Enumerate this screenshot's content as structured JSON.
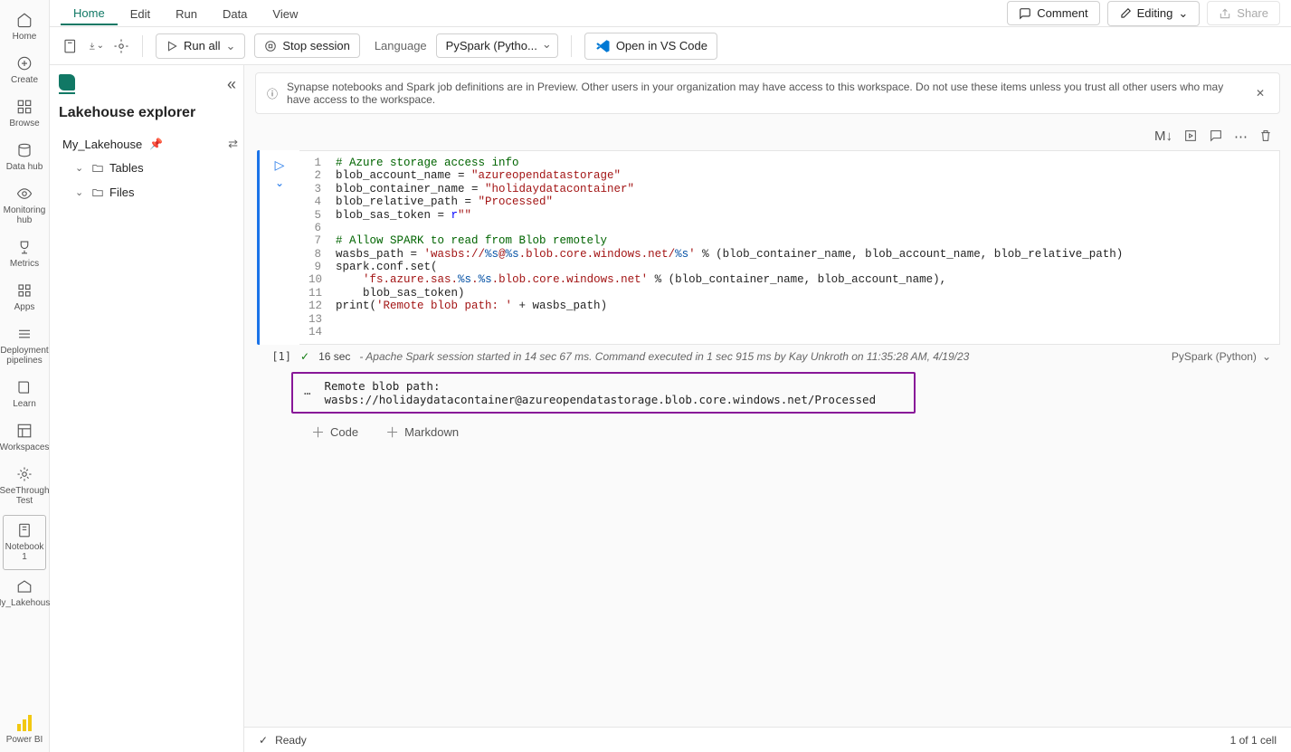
{
  "nav": {
    "home": "Home",
    "create": "Create",
    "browse": "Browse",
    "datahub": "Data hub",
    "monitoring": "Monitoring hub",
    "metrics": "Metrics",
    "apps": "Apps",
    "pipelines": "Deployment pipelines",
    "learn": "Learn",
    "workspaces": "Workspaces",
    "seethrough": "SeeThrough Test",
    "notebook": "Notebook 1",
    "lakehouse": "My_Lakehouse",
    "powerbi": "Power BI"
  },
  "ribbon": {
    "tabs": [
      "Home",
      "Edit",
      "Run",
      "Data",
      "View"
    ],
    "comment": "Comment",
    "editing": "Editing",
    "share": "Share"
  },
  "toolbar": {
    "run_all": "Run all",
    "stop": "Stop session",
    "language_label": "Language",
    "language_value": "PySpark (Pytho...",
    "open_vscode": "Open in VS Code"
  },
  "explorer": {
    "title": "Lakehouse explorer",
    "lakehouse": "My_Lakehouse",
    "tables": "Tables",
    "files": "Files"
  },
  "info_bar": "Synapse notebooks and Spark job definitions are in Preview. Other users in your organization may have access to this workspace. Do not use these items unless you trust all other users who may have access to the workspace.",
  "cell_actions": {
    "md": "M↓"
  },
  "code_lines": [
    {
      "n": "1",
      "html": "<span class='c-comment'># Azure storage access info</span>"
    },
    {
      "n": "2",
      "html": "blob_account_name = <span class='c-str'>\"azureopendatastorage\"</span>"
    },
    {
      "n": "3",
      "html": "blob_container_name = <span class='c-str'>\"holidaydatacontainer\"</span>"
    },
    {
      "n": "4",
      "html": "blob_relative_path = <span class='c-str'>\"Processed\"</span>"
    },
    {
      "n": "5",
      "html": "blob_sas_token = <span class='c-kw'>r</span><span class='c-str'>\"\"</span>"
    },
    {
      "n": "6",
      "html": ""
    },
    {
      "n": "7",
      "html": "<span class='c-comment'># Allow SPARK to read from Blob remotely</span>"
    },
    {
      "n": "8",
      "html": "wasbs_path = <span class='c-str'>'wasbs://</span><span class='c-pct'>%s</span><span class='c-str'>@</span><span class='c-pct'>%s</span><span class='c-str'>.blob.core.windows.net/</span><span class='c-pct'>%s</span><span class='c-str'>'</span> % (blob_container_name, blob_account_name, blob_relative_path)"
    },
    {
      "n": "9",
      "html": "spark.conf.set("
    },
    {
      "n": "10",
      "html": "    <span class='c-str'>'fs.azure.sas.</span><span class='c-pct'>%s</span><span class='c-str'>.</span><span class='c-pct'>%s</span><span class='c-str'>.blob.core.windows.net'</span> % (blob_container_name, blob_account_name),"
    },
    {
      "n": "11",
      "html": "    blob_sas_token)"
    },
    {
      "n": "12",
      "html": "print(<span class='c-str'>'Remote blob path: '</span> + wasbs_path)"
    },
    {
      "n": "13",
      "html": ""
    },
    {
      "n": "14",
      "html": ""
    }
  ],
  "exec": {
    "index": "[1]",
    "duration": "16 sec",
    "details": "- Apache Spark session started in 14 sec 67 ms. Command executed in 1 sec 915 ms by Kay Unkroth on 11:35:28 AM, 4/19/23",
    "lang": "PySpark (Python)"
  },
  "output": "Remote blob path: wasbs://holidaydatacontainer@azureopendatastorage.blob.core.windows.net/Processed",
  "add": {
    "code": "Code",
    "markdown": "Markdown"
  },
  "status": {
    "ready": "Ready",
    "cells": "1 of 1 cell"
  }
}
